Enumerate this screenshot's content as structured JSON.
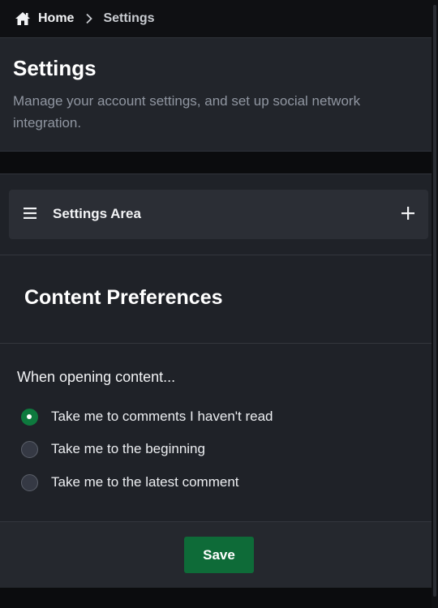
{
  "breadcrumb": {
    "home_label": "Home",
    "current_label": "Settings",
    "home_icon": "home-icon",
    "separator_icon": "chevron-right-icon"
  },
  "header": {
    "title": "Settings",
    "description": "Manage your account settings, and set up social network integration."
  },
  "settings_area": {
    "label": "Settings Area",
    "menu_icon": "menu-icon",
    "expand_icon": "plus-icon"
  },
  "section": {
    "title": "Content Preferences",
    "group_label": "When opening content...",
    "options": [
      {
        "label": "Take me to comments I haven't read",
        "checked": true
      },
      {
        "label": "Take me to the beginning",
        "checked": false
      },
      {
        "label": "Take me to the latest comment",
        "checked": false
      }
    ]
  },
  "footer": {
    "save_label": "Save"
  },
  "colors": {
    "accent": "#0e7a3e",
    "button": "#0e6b38",
    "panel": "#22252b",
    "background": "#0b0c0e"
  }
}
